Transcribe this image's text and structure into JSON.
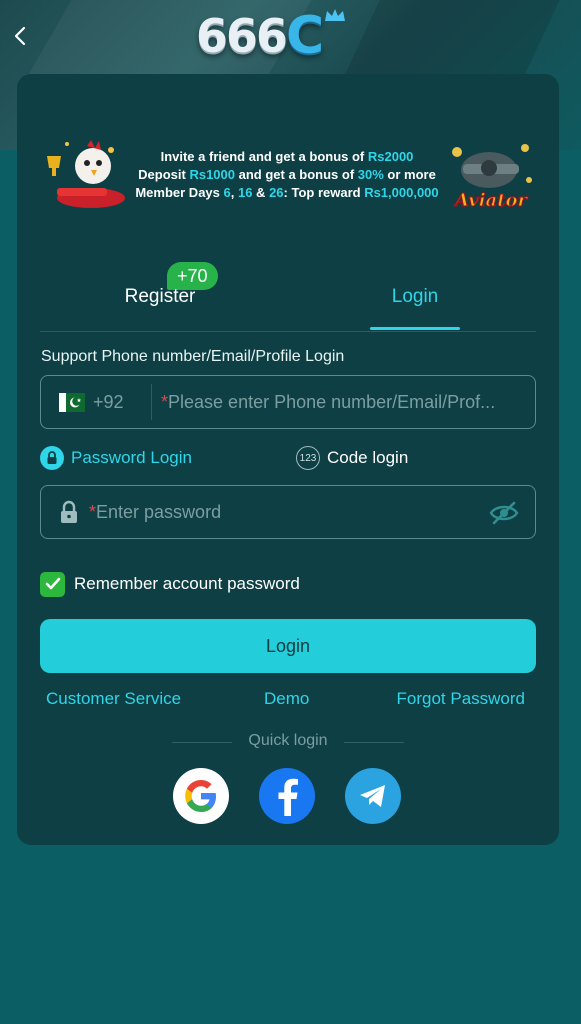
{
  "header": {
    "back_icon": "chevron-left-icon",
    "logo_text": "666",
    "logo_c": "C"
  },
  "banner": {
    "line1_pre": "Invite a friend and get a bonus of ",
    "line1_amount": "Rs2000",
    "line2_pre": "Deposit ",
    "line2_amount": "Rs1000",
    "line2_mid": " and get a bonus of ",
    "line2_pct": "30%",
    "line2_post": " or more",
    "line3_pre": "Member Days ",
    "line3_d1": "6",
    "line3_sep1": ", ",
    "line3_d2": "16",
    "line3_sep2": " & ",
    "line3_d3": "26",
    "line3_mid": ": Top reward ",
    "line3_amount": "Rs1,000,000",
    "right_logo_text": "Aviator"
  },
  "tabs": {
    "register_label": "Register",
    "register_badge": "+70",
    "login_label": "Login",
    "active": "login"
  },
  "form": {
    "support_label": "Support Phone number/Email/Profile Login",
    "country_prefix": "+92",
    "phone_required": "*",
    "phone_placeholder": "Please enter Phone number/Email/Prof...",
    "password_mode_label": "Password Login",
    "code_mode_icon": "123",
    "code_mode_label": "Code login",
    "password_required": "*",
    "password_placeholder": "Enter password",
    "remember_label": "Remember account password",
    "remember_checked": true,
    "login_button": "Login"
  },
  "links": {
    "customer_service": "Customer Service",
    "demo": "Demo",
    "forgot_password": "Forgot Password"
  },
  "quick_login": {
    "label": "Quick login",
    "providers": [
      "google",
      "facebook",
      "telegram"
    ]
  },
  "colors": {
    "accent": "#2fd5e8",
    "button": "#23cdd9",
    "card": "#0d3f44",
    "page": "#0b5e63",
    "check": "#2bb83d",
    "badge": "#27b34a"
  }
}
